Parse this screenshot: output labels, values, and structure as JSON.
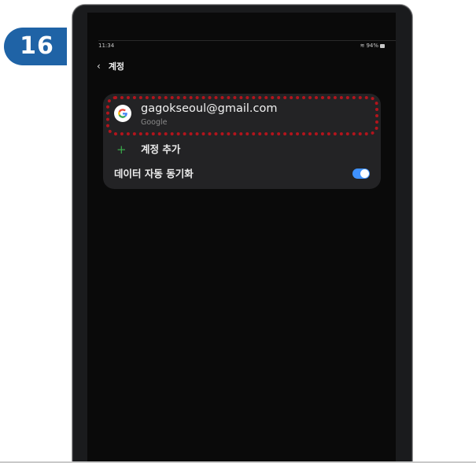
{
  "step": {
    "number": "16",
    "color": "#1f63a6"
  },
  "status_bar": {
    "time": "11:34",
    "battery": "94%",
    "icons": [
      "wifi-icon",
      "battery-icon"
    ]
  },
  "header": {
    "back_icon": "chevron-left-icon",
    "title": "계정"
  },
  "account": {
    "icon": "google-icon",
    "email": "gagokseoul@gmail.com",
    "type": "Google",
    "highlight_color": "#b3141c"
  },
  "add_account": {
    "icon": "plus-icon",
    "label": "계정 추가"
  },
  "sync": {
    "label": "데이터 자동 동기화",
    "toggle_on": true,
    "toggle_color": "#3e91ff"
  }
}
